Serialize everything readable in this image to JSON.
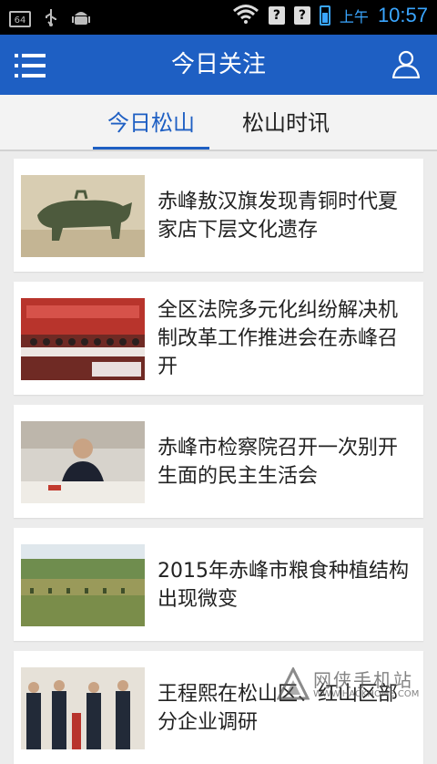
{
  "statusbar": {
    "notif_badge": "64",
    "ampm": "上午",
    "time": "10:57",
    "icons": [
      "notification-64-icon",
      "usb-icon",
      "android-debug-icon",
      "wifi-icon",
      "no-sim-icon",
      "no-signal-icon",
      "battery-charging-icon"
    ]
  },
  "appbar": {
    "title": "今日关注",
    "left_icon": "menu-icon",
    "right_icon": "user-icon",
    "color": "#1e5fc3"
  },
  "tabs": [
    {
      "label": "今日松山",
      "active": true
    },
    {
      "label": "松山时讯",
      "active": false
    }
  ],
  "articles": [
    {
      "title": "赤峰敖汉旗发现青铜时代夏家店下层文化遗存",
      "thumb": "bronze-artifact-photo"
    },
    {
      "title": "全区法院多元化纠纷解决机制改革工作推进会在赤峰召开",
      "thumb": "court-meeting-photo"
    },
    {
      "title": "赤峰市检察院召开一次别开生面的民主生活会",
      "thumb": "procuratorate-meeting-photo"
    },
    {
      "title": "2015年赤峰市粮食种植结构出现微变",
      "thumb": "farmland-photo"
    },
    {
      "title": "王程熙在松山区、红山区部分企业调研",
      "thumb": "official-visit-photo"
    }
  ],
  "watermark": {
    "text": "网侠手机站",
    "url": "WWW.HACKHOME.COM"
  }
}
